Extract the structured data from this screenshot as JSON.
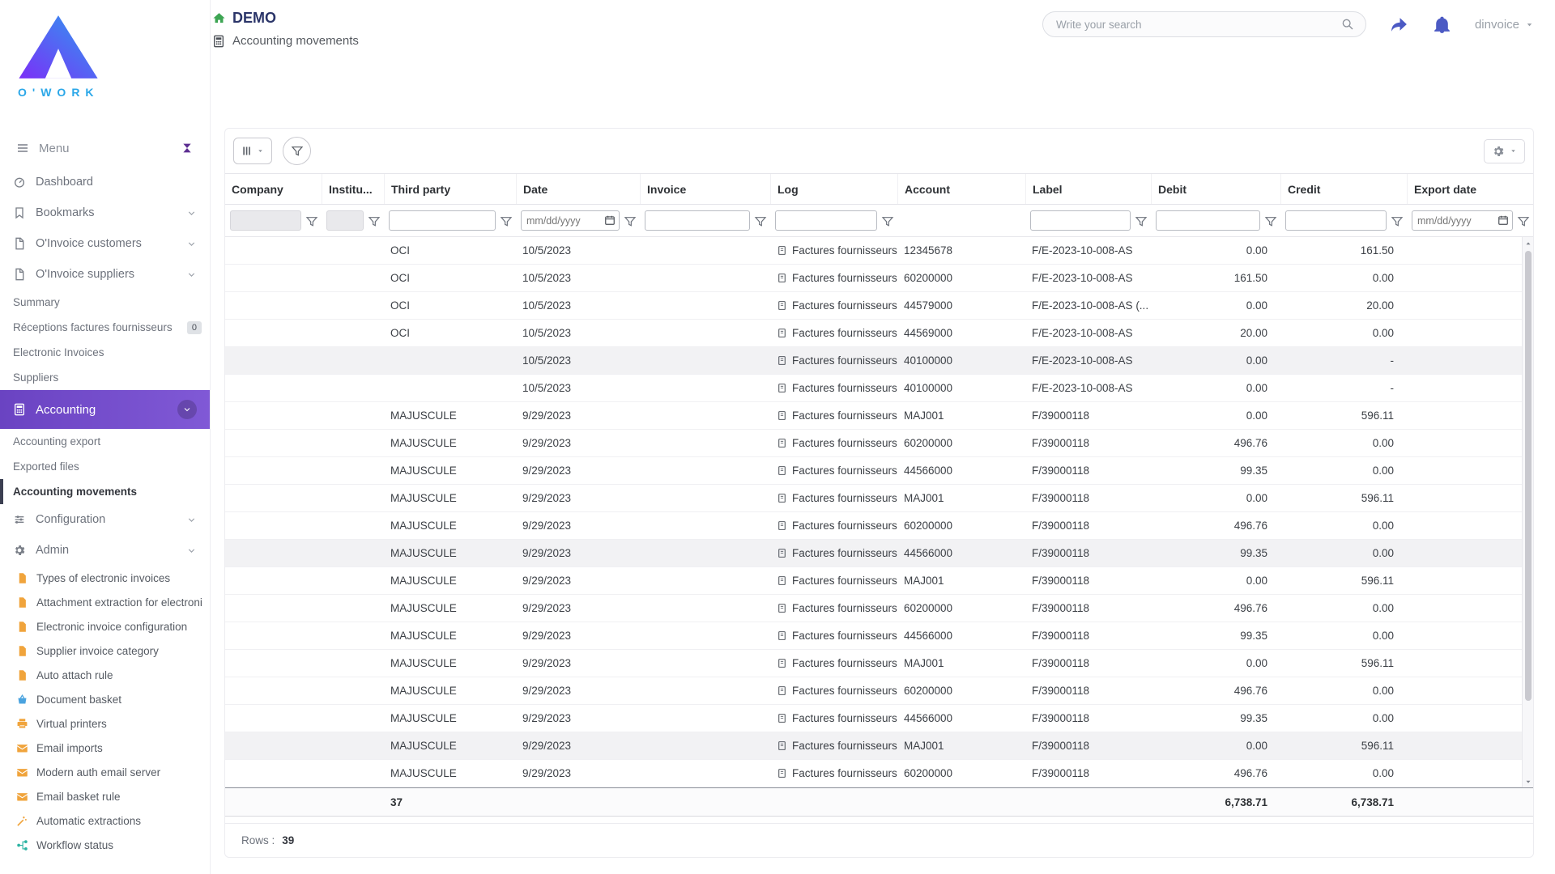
{
  "colors": {
    "accent_purple": "#6f4bc8",
    "logo_blue": "#2ba7e8",
    "title_navy": "#2b3569",
    "header_icon_indigo": "#4c5ac4",
    "home_green": "#3da553",
    "admin_icon_orange": "#f0a43c",
    "basket_icon_blue": "#4aa3df",
    "workflow_icon_teal": "#2bb3a2"
  },
  "icons": [
    "logo",
    "home-icon",
    "calculator-icon",
    "search-icon",
    "share-icon",
    "bell-icon",
    "caret-down-icon",
    "hamburger-icon",
    "collapse-sidebar-icon",
    "dashboard-icon",
    "bookmark-icon",
    "file-icon",
    "sliders-icon",
    "gear-icon",
    "document-icon",
    "basket-icon",
    "printer-icon",
    "mail-icon",
    "wand-icon",
    "workflow-icon",
    "funnel-icon",
    "columns-icon",
    "calendar-icon",
    "log-icon",
    "chevron-down-icon",
    "scroll-up-icon",
    "scroll-down-icon"
  ],
  "brand": {
    "logo_text": "O'WORK"
  },
  "header": {
    "app_title": "DEMO",
    "breadcrumb": "Accounting movements",
    "search_placeholder": "Write your search",
    "username": "dinvoice"
  },
  "sidebar": {
    "menu_label": "Menu",
    "items": [
      {
        "label": "Dashboard"
      },
      {
        "label": "Bookmarks"
      },
      {
        "label": "O'Invoice customers"
      },
      {
        "label": "O'Invoice suppliers"
      },
      {
        "label": "Summary"
      },
      {
        "label": "Réceptions factures fournisseurs",
        "badge": "0"
      },
      {
        "label": "Electronic Invoices"
      },
      {
        "label": "Suppliers"
      },
      {
        "label": "Accounting"
      },
      {
        "label": "Accounting export"
      },
      {
        "label": "Exported files"
      },
      {
        "label": "Accounting movements"
      },
      {
        "label": "Configuration"
      },
      {
        "label": "Admin"
      },
      {
        "label": "Types of electronic invoices"
      },
      {
        "label": "Attachment extraction for electroni"
      },
      {
        "label": "Electronic invoice configuration"
      },
      {
        "label": "Supplier invoice category"
      },
      {
        "label": "Auto attach rule"
      },
      {
        "label": "Document basket"
      },
      {
        "label": "Virtual printers"
      },
      {
        "label": "Email imports"
      },
      {
        "label": "Modern auth email server"
      },
      {
        "label": "Email basket rule"
      },
      {
        "label": "Automatic extractions"
      },
      {
        "label": "Workflow status"
      }
    ]
  },
  "grid": {
    "columns": [
      "Company",
      "Institu...",
      "Third party",
      "Date",
      "Invoice",
      "Log",
      "Account",
      "Label",
      "Debit",
      "Credit",
      "Export date"
    ],
    "filters": {
      "date_placeholder": "mm/dd/yyyy"
    },
    "rows": [
      {
        "third_party": "OCI",
        "date": "10/5/2023",
        "log": "Factures fournisseurs",
        "account": "12345678",
        "label": "F/E-2023-10-008-AS",
        "debit": "0.00",
        "credit": "161.50"
      },
      {
        "third_party": "OCI",
        "date": "10/5/2023",
        "log": "Factures fournisseurs",
        "account": "60200000",
        "label": "F/E-2023-10-008-AS",
        "debit": "161.50",
        "credit": "0.00"
      },
      {
        "third_party": "OCI",
        "date": "10/5/2023",
        "log": "Factures fournisseurs",
        "account": "44579000",
        "label": "F/E-2023-10-008-AS (...",
        "debit": "0.00",
        "credit": "20.00"
      },
      {
        "third_party": "OCI",
        "date": "10/5/2023",
        "log": "Factures fournisseurs",
        "account": "44569000",
        "label": "F/E-2023-10-008-AS",
        "debit": "20.00",
        "credit": "0.00"
      },
      {
        "third_party": "",
        "date": "10/5/2023",
        "log": "Factures fournisseurs",
        "account": "40100000",
        "label": "F/E-2023-10-008-AS",
        "debit": "0.00",
        "credit": "-",
        "highlighted": true
      },
      {
        "third_party": "",
        "date": "10/5/2023",
        "log": "Factures fournisseurs",
        "account": "40100000",
        "label": "F/E-2023-10-008-AS",
        "debit": "0.00",
        "credit": "-"
      },
      {
        "third_party": "MAJUSCULE",
        "date": "9/29/2023",
        "log": "Factures fournisseurs",
        "account": "MAJ001",
        "label": "F/39000118",
        "debit": "0.00",
        "credit": "596.11"
      },
      {
        "third_party": "MAJUSCULE",
        "date": "9/29/2023",
        "log": "Factures fournisseurs",
        "account": "60200000",
        "label": "F/39000118",
        "debit": "496.76",
        "credit": "0.00"
      },
      {
        "third_party": "MAJUSCULE",
        "date": "9/29/2023",
        "log": "Factures fournisseurs",
        "account": "44566000",
        "label": "F/39000118",
        "debit": "99.35",
        "credit": "0.00"
      },
      {
        "third_party": "MAJUSCULE",
        "date": "9/29/2023",
        "log": "Factures fournisseurs",
        "account": "MAJ001",
        "label": "F/39000118",
        "debit": "0.00",
        "credit": "596.11"
      },
      {
        "third_party": "MAJUSCULE",
        "date": "9/29/2023",
        "log": "Factures fournisseurs",
        "account": "60200000",
        "label": "F/39000118",
        "debit": "496.76",
        "credit": "0.00"
      },
      {
        "third_party": "MAJUSCULE",
        "date": "9/29/2023",
        "log": "Factures fournisseurs",
        "account": "44566000",
        "label": "F/39000118",
        "debit": "99.35",
        "credit": "0.00",
        "highlighted": true
      },
      {
        "third_party": "MAJUSCULE",
        "date": "9/29/2023",
        "log": "Factures fournisseurs",
        "account": "MAJ001",
        "label": "F/39000118",
        "debit": "0.00",
        "credit": "596.11"
      },
      {
        "third_party": "MAJUSCULE",
        "date": "9/29/2023",
        "log": "Factures fournisseurs",
        "account": "60200000",
        "label": "F/39000118",
        "debit": "496.76",
        "credit": "0.00"
      },
      {
        "third_party": "MAJUSCULE",
        "date": "9/29/2023",
        "log": "Factures fournisseurs",
        "account": "44566000",
        "label": "F/39000118",
        "debit": "99.35",
        "credit": "0.00"
      },
      {
        "third_party": "MAJUSCULE",
        "date": "9/29/2023",
        "log": "Factures fournisseurs",
        "account": "MAJ001",
        "label": "F/39000118",
        "debit": "0.00",
        "credit": "596.11"
      },
      {
        "third_party": "MAJUSCULE",
        "date": "9/29/2023",
        "log": "Factures fournisseurs",
        "account": "60200000",
        "label": "F/39000118",
        "debit": "496.76",
        "credit": "0.00"
      },
      {
        "third_party": "MAJUSCULE",
        "date": "9/29/2023",
        "log": "Factures fournisseurs",
        "account": "44566000",
        "label": "F/39000118",
        "debit": "99.35",
        "credit": "0.00"
      },
      {
        "third_party": "MAJUSCULE",
        "date": "9/29/2023",
        "log": "Factures fournisseurs",
        "account": "MAJ001",
        "label": "F/39000118",
        "debit": "0.00",
        "credit": "596.11",
        "highlighted": true
      },
      {
        "third_party": "MAJUSCULE",
        "date": "9/29/2023",
        "log": "Factures fournisseurs",
        "account": "60200000",
        "label": "F/39000118",
        "debit": "496.76",
        "credit": "0.00"
      }
    ],
    "totals": {
      "count": "37",
      "debit": "6,738.71",
      "credit": "6,738.71"
    }
  },
  "footer": {
    "rows_label": "Rows :",
    "rows_value": "39"
  }
}
